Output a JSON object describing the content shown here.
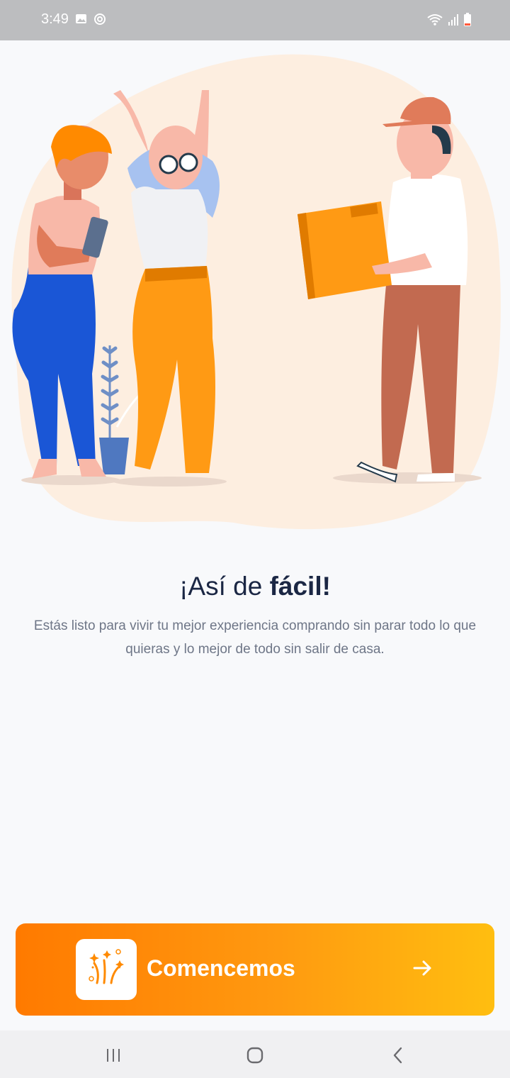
{
  "status": {
    "time": "3:49"
  },
  "heading": {
    "prefix": "¡Así de ",
    "bold": "fácil!"
  },
  "description": "Estás listo para vivir tu mejor experiencia comprando sin parar todo lo que quieras y lo mejor de todo sin salir de casa.",
  "cta": {
    "label": "Comencemos",
    "icon": "fireworks-icon",
    "arrow": "arrow-right-icon"
  },
  "nav": {
    "recents": "recents-icon",
    "home": "home-icon",
    "back": "back-icon"
  },
  "colors": {
    "accent_start": "#ff7a00",
    "accent_end": "#ffbe10",
    "title": "#1b2744",
    "text": "#6e7687"
  }
}
